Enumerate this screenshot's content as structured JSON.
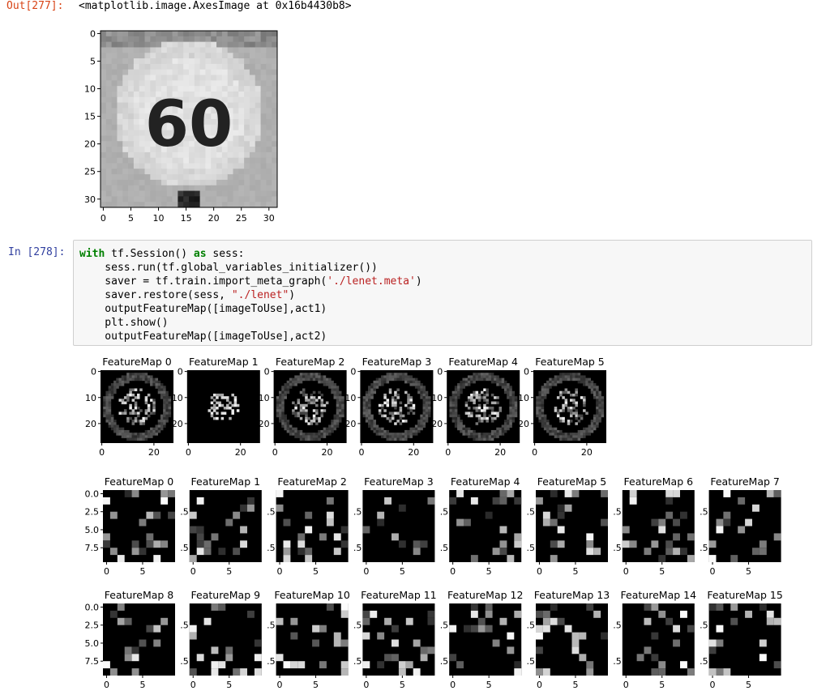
{
  "out_cell": {
    "prompt": "Out[277]:",
    "text": "<matplotlib.image.AxesImage at 0x16b4430b8>"
  },
  "sign_image": {
    "y_ticks": [
      "0",
      "5",
      "10",
      "15",
      "20",
      "25",
      "30"
    ],
    "x_ticks": [
      "0",
      "5",
      "10",
      "15",
      "20",
      "25",
      "30"
    ],
    "sign_text": "60"
  },
  "in_cell": {
    "prompt": "In [278]:",
    "lines": [
      [
        {
          "t": "with",
          "c": "kw"
        },
        {
          "t": " tf.Session() ",
          "c": ""
        },
        {
          "t": "as",
          "c": "kw"
        },
        {
          "t": " sess:",
          "c": ""
        }
      ],
      [
        {
          "t": "    sess.run(tf.global_variables_initializer())",
          "c": ""
        }
      ],
      [
        {
          "t": "    saver = tf.train.import_meta_graph(",
          "c": ""
        },
        {
          "t": "'./lenet.meta'",
          "c": "str"
        },
        {
          "t": ")",
          "c": ""
        }
      ],
      [
        {
          "t": "    saver.restore(sess, ",
          "c": ""
        },
        {
          "t": "\"./lenet\"",
          "c": "str"
        },
        {
          "t": ")",
          "c": ""
        }
      ],
      [
        {
          "t": "    outputFeatureMap([imageToUse],act1)",
          "c": ""
        }
      ],
      [
        {
          "t": "    plt.show()",
          "c": ""
        }
      ],
      [
        {
          "t": "    outputFeatureMap([imageToUse],act2)",
          "c": ""
        }
      ]
    ]
  },
  "act1": {
    "titles": [
      "FeatureMap 0",
      "FeatureMap 1",
      "FeatureMap 2",
      "FeatureMap 3",
      "FeatureMap 4",
      "FeatureMap 5"
    ],
    "y_ticks": [
      "0",
      "10",
      "20"
    ],
    "x_ticks": [
      "0",
      "20"
    ]
  },
  "act2_row1": {
    "titles": [
      "FeatureMap 0",
      "FeatureMap 1",
      "FeatureMap 2",
      "FeatureMap 3",
      "FeatureMap 4",
      "FeatureMap 5",
      "FeatureMap 6",
      "FeatureMap 7"
    ],
    "y_ticks": [
      "0.0",
      "2.5",
      "5.0",
      "7.5"
    ],
    "y_ticks_clipped": [
      ".5",
      ".5"
    ],
    "x_ticks": [
      "0",
      "5"
    ]
  },
  "act2_row2": {
    "titles": [
      "FeatureMap 8",
      "FeatureMap 9",
      "FeatureMap 10",
      "FeatureMap 11",
      "FeatureMap 12",
      "FeatureMap 13",
      "FeatureMap 14",
      "FeatureMap 15"
    ],
    "y_ticks": [
      "0.0",
      "2.5",
      "5.0",
      "7.5"
    ],
    "y_ticks_clipped": [
      ".5",
      ".5",
      "7.5"
    ],
    "x_ticks": [
      "0",
      "5"
    ]
  },
  "colors": {
    "out_prompt": "#d84315",
    "in_prompt": "#303f9f",
    "keyword": "#008000",
    "string": "#ba2121",
    "cell_bg": "#f7f7f7"
  }
}
